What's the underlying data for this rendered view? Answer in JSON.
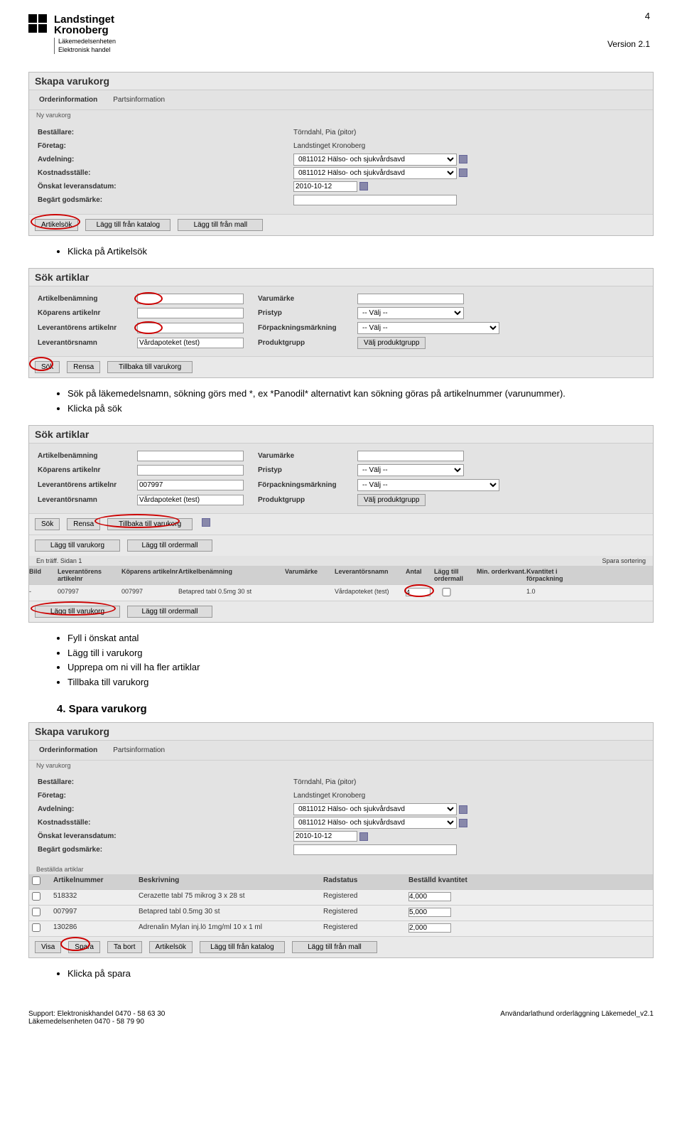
{
  "page": {
    "number": "4",
    "version": "Version 2.1"
  },
  "header": {
    "brand_line1": "Landstinget",
    "brand_line2": "Kronoberg",
    "sub1": "Läkemedelsenheten",
    "sub2": "Elektronisk handel"
  },
  "bullets1": {
    "b1": "Klicka på Artikelsök"
  },
  "bullets2": {
    "b1": "Sök på läkemedelsnamn, sökning görs med *, ex *Panodil* alternativt kan sökning göras på artikelnummer (varunummer).",
    "b2": "Klicka på sök"
  },
  "bullets3": {
    "b1": "Fyll i önskat antal",
    "b2": "Lägg till i varukorg",
    "b3": "Upprepa om ni vill ha fler artiklar",
    "b4": "Tillbaka till varukorg"
  },
  "section4": "4. Spara varukorg",
  "bullets4": {
    "b1": "Klicka på spara"
  },
  "skapa": {
    "title": "Skapa varukorg",
    "tab1": "Orderinformation",
    "tab2": "Partsinformation",
    "group": "Ny varukorg",
    "labels": {
      "bestallare": "Beställare:",
      "foretag": "Företag:",
      "avdelning": "Avdelning:",
      "kostnadsstalle": "Kostnadsställe:",
      "leveransdatum": "Önskat leveransdatum:",
      "godsmarke": "Begärt godsmärke:"
    },
    "values": {
      "bestallare": "Törndahl, Pia (pitor)",
      "foretag": "Landstinget Kronoberg",
      "avdelning": "0811012 Hälso- och sjukvårdsavd",
      "kostnadsstalle": "0811012 Hälso- och sjukvårdsavd",
      "leveransdatum": "2010-10-12",
      "godsmarke": ""
    },
    "buttons": {
      "artikelsok": "Artikelsök",
      "fran_katalog": "Lägg till från katalog",
      "fran_mall": "Lägg till från mall"
    }
  },
  "sok": {
    "title": "Sök artiklar",
    "labels": {
      "artikelbenamning": "Artikelbenämning",
      "koparens": "Köparens artikelnr",
      "leverantorens": "Leverantörens artikelnr",
      "leverantorsnamn": "Leverantörsnamn",
      "varumarke": "Varumärke",
      "pristyp": "Pristyp",
      "forpackningsmarkning": "Förpackningsmärkning",
      "produktgrupp": "Produktgrupp"
    },
    "values": {
      "pristyp": "-- Välj --",
      "forpack": "-- Välj --",
      "leverantorsnamn": "Vårdapoteket (test)",
      "produkt_btn": "Välj produktgrupp"
    },
    "buttons": {
      "sok": "Sök",
      "rensa": "Rensa",
      "tillbaka": "Tillbaka till varukorg"
    }
  },
  "sok2": {
    "leverantorens_val": "007997",
    "btn_lagg_varukorg": "Lägg till varukorg",
    "btn_lagg_ordermall": "Lägg till ordermall",
    "hits": "En träff. Sidan 1",
    "sort": "Spara sortering",
    "head": {
      "bild": "Bild",
      "lev_art": "Leverantörens artikelnr",
      "kop_art": "Köparens artikelnr",
      "benamning": "Artikelbenämning",
      "varumarke": "Varumärke",
      "levnamn": "Leverantörsnamn",
      "antal": "Antal",
      "lagg_ordermall": "Lägg till ordermall",
      "min_order": "Min. orderkvant.",
      "kvant_forpack": "Kvantitet i förpackning"
    },
    "row": {
      "lev_art": "007997",
      "kop_art": "007997",
      "benamning": "Betapred tabl 0.5mg 30 st",
      "levnamn": "Vårdapoteket (test)",
      "antal": "4",
      "min_order": "",
      "kvant": "1.0"
    }
  },
  "bestallda": {
    "group": "Beställda artiklar",
    "head": {
      "art": "Artikelnummer",
      "beskr": "Beskrivning",
      "rad": "Radstatus",
      "kvant": "Beställd kvantitet"
    },
    "rows": [
      {
        "art": "518332",
        "beskr": "Cerazette tabl 75 mikrog 3 x 28 st",
        "rad": "Registered",
        "kvant": "4,000"
      },
      {
        "art": "007997",
        "beskr": "Betapred tabl 0.5mg 30 st",
        "rad": "Registered",
        "kvant": "5,000"
      },
      {
        "art": "130286",
        "beskr": "Adrenalin Mylan inj.lö 1mg/ml 10 x 1 ml",
        "rad": "Registered",
        "kvant": "2,000"
      }
    ],
    "buttons": {
      "visa": "Visa",
      "spara": "Spara",
      "tabort": "Ta bort",
      "artikelsok": "Artikelsök",
      "katalog": "Lägg till från katalog",
      "mall": "Lägg till från mall"
    }
  },
  "footer": {
    "left1": "Support: Elektroniskhandel  0470 - 58 63 30",
    "left2": "Läkemedelsenheten 0470 - 58 79 90",
    "right": "Användarlathund orderläggning Läkemedel_v2.1"
  }
}
